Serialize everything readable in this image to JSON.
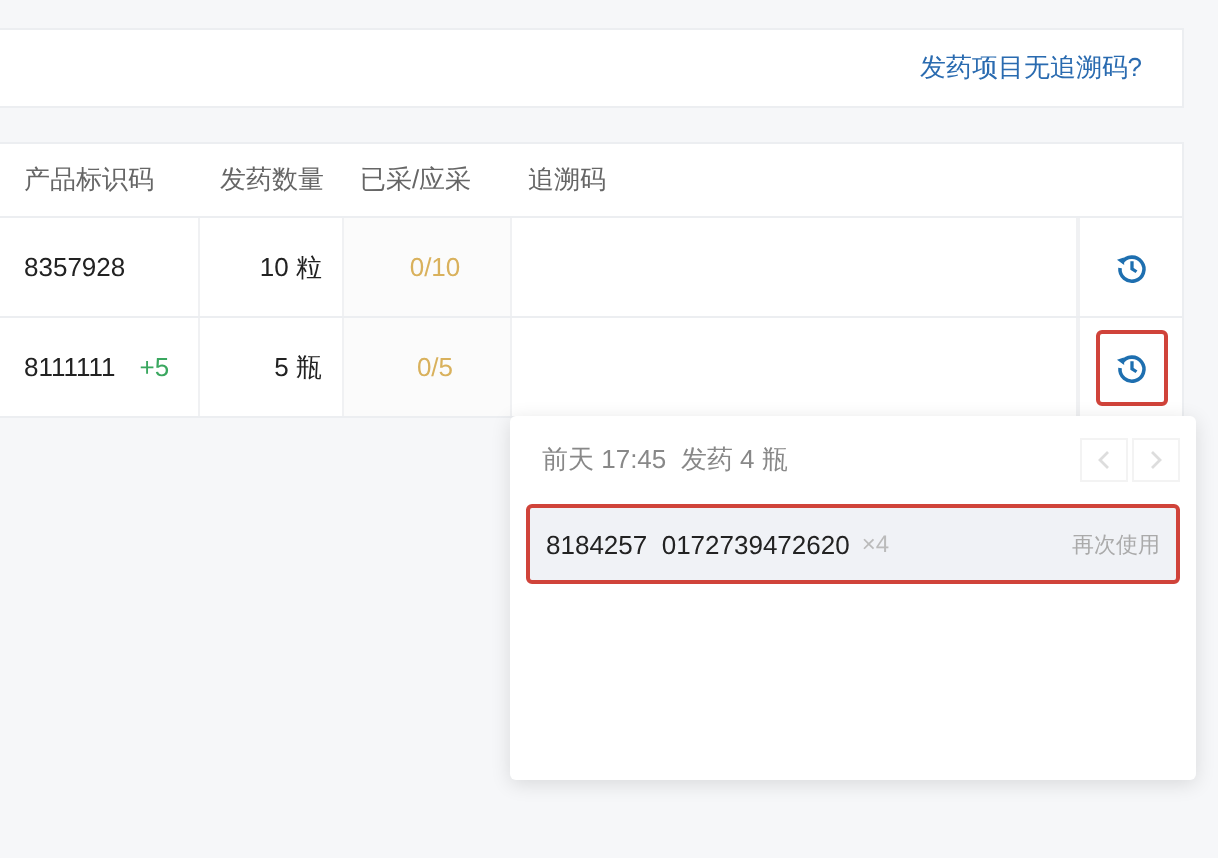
{
  "notice": {
    "link": "发药项目无追溯码?"
  },
  "table": {
    "columns": [
      "产品标识码",
      "发药数量",
      "已采/应采",
      "追溯码"
    ],
    "rows": [
      {
        "code": "8357928",
        "extra": "",
        "quantity": "10 粒",
        "collected": "0/10",
        "highlighted": false
      },
      {
        "code": "8111111",
        "extra": "+5",
        "quantity": "5 瓶",
        "collected": "0/5",
        "highlighted": true
      }
    ]
  },
  "popover": {
    "title": "前天 17:45  发药 4 瓶",
    "prev_disabled": true,
    "next_disabled": true,
    "items": [
      {
        "code": "8184257  0172739472620",
        "count": "×4",
        "action": "再次使用",
        "highlighted": true
      }
    ]
  }
}
